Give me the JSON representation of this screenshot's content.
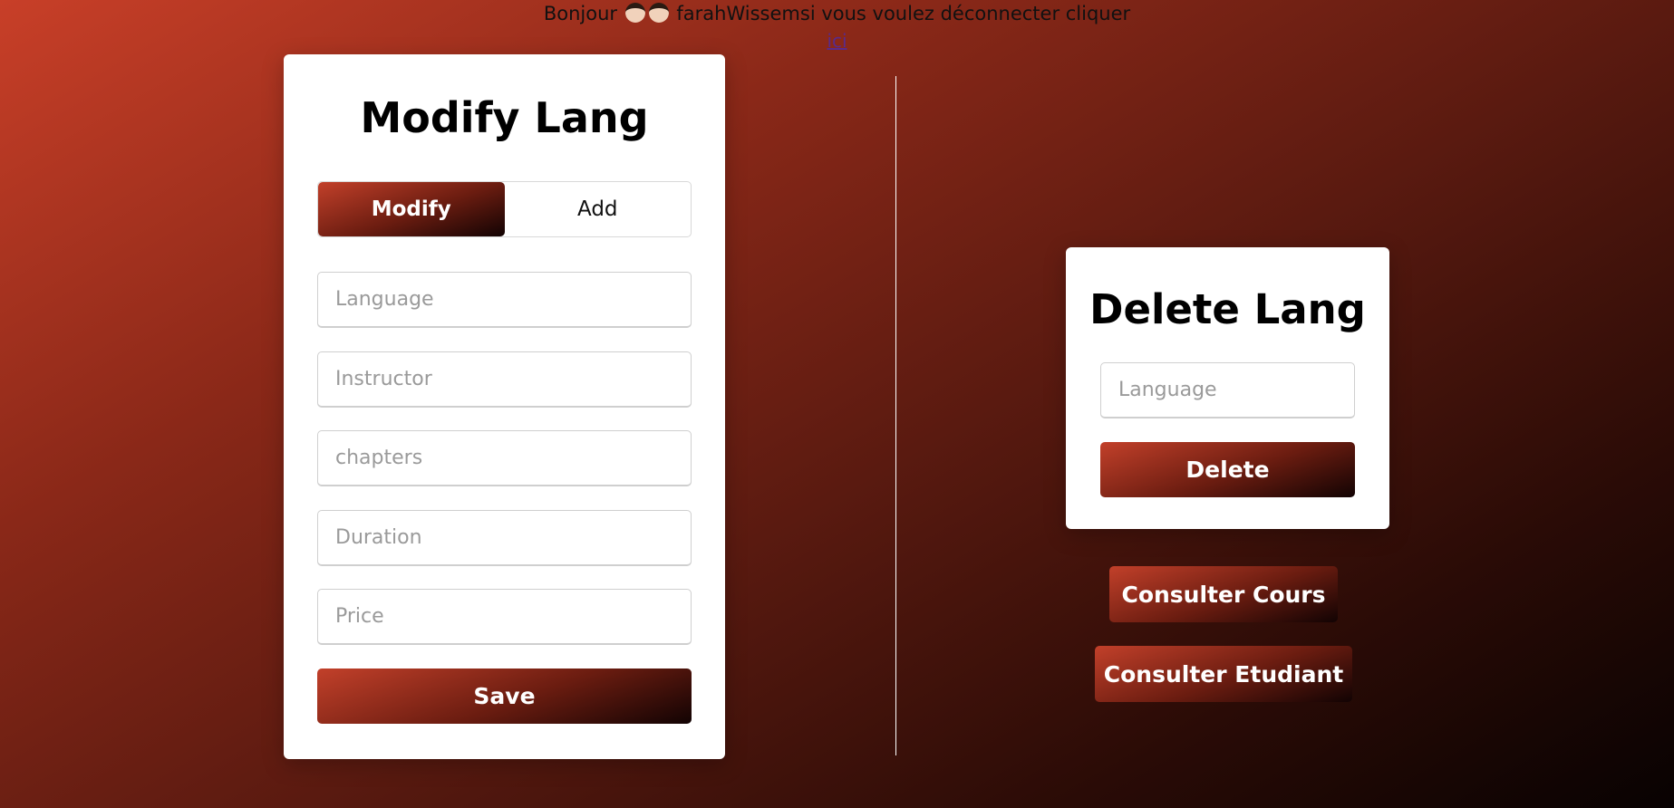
{
  "header": {
    "greeting_prefix": "Bonjour",
    "face_icons": [
      "boy-face-icon",
      "boy-face-icon"
    ],
    "greeting_suffix": "farahWissemsi vous voulez déconnecter cliquer",
    "logout_link": "ici"
  },
  "modify_card": {
    "title": "Modify Lang",
    "tabs": [
      {
        "label": "Modify",
        "active": true
      },
      {
        "label": "Add",
        "active": false
      }
    ],
    "fields": [
      {
        "placeholder": "Language",
        "value": ""
      },
      {
        "placeholder": "Instructor",
        "value": ""
      },
      {
        "placeholder": "chapters",
        "value": ""
      },
      {
        "placeholder": "Duration",
        "value": ""
      },
      {
        "placeholder": "Price",
        "value": ""
      }
    ],
    "save_label": "Save"
  },
  "delete_card": {
    "title": "Delete Lang",
    "field": {
      "placeholder": "Language",
      "value": ""
    },
    "delete_label": "Delete"
  },
  "actions": {
    "consulter_cours": "Consulter Cours",
    "consulter_etudiant": "Consulter Etudiant"
  },
  "colors": {
    "accent_start": "#c2402a",
    "accent_end": "#120303",
    "card_bg": "#ffffff"
  }
}
